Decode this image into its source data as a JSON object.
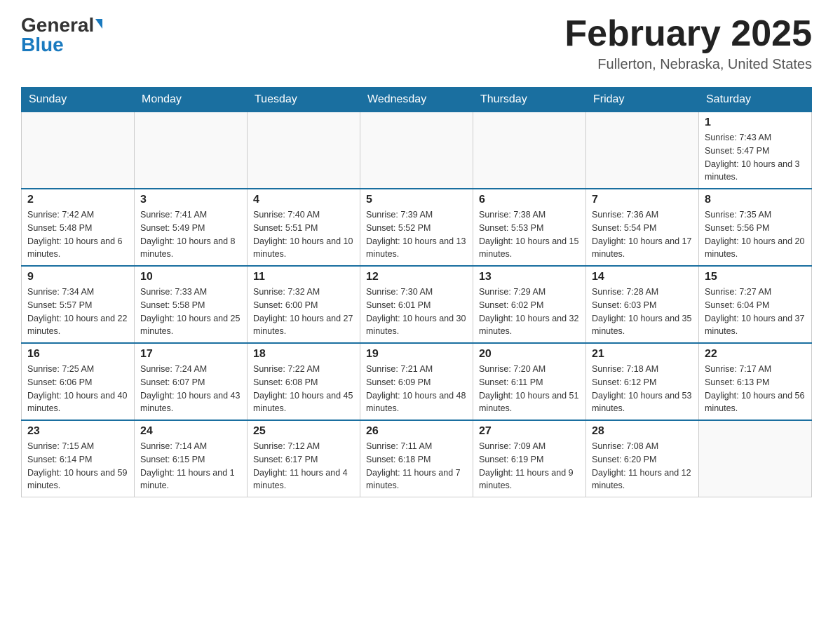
{
  "header": {
    "logo": {
      "general": "General",
      "blue": "Blue"
    },
    "title": "February 2025",
    "subtitle": "Fullerton, Nebraska, United States"
  },
  "weekdays": [
    "Sunday",
    "Monday",
    "Tuesday",
    "Wednesday",
    "Thursday",
    "Friday",
    "Saturday"
  ],
  "weeks": [
    [
      {
        "day": "",
        "info": ""
      },
      {
        "day": "",
        "info": ""
      },
      {
        "day": "",
        "info": ""
      },
      {
        "day": "",
        "info": ""
      },
      {
        "day": "",
        "info": ""
      },
      {
        "day": "",
        "info": ""
      },
      {
        "day": "1",
        "info": "Sunrise: 7:43 AM\nSunset: 5:47 PM\nDaylight: 10 hours and 3 minutes."
      }
    ],
    [
      {
        "day": "2",
        "info": "Sunrise: 7:42 AM\nSunset: 5:48 PM\nDaylight: 10 hours and 6 minutes."
      },
      {
        "day": "3",
        "info": "Sunrise: 7:41 AM\nSunset: 5:49 PM\nDaylight: 10 hours and 8 minutes."
      },
      {
        "day": "4",
        "info": "Sunrise: 7:40 AM\nSunset: 5:51 PM\nDaylight: 10 hours and 10 minutes."
      },
      {
        "day": "5",
        "info": "Sunrise: 7:39 AM\nSunset: 5:52 PM\nDaylight: 10 hours and 13 minutes."
      },
      {
        "day": "6",
        "info": "Sunrise: 7:38 AM\nSunset: 5:53 PM\nDaylight: 10 hours and 15 minutes."
      },
      {
        "day": "7",
        "info": "Sunrise: 7:36 AM\nSunset: 5:54 PM\nDaylight: 10 hours and 17 minutes."
      },
      {
        "day": "8",
        "info": "Sunrise: 7:35 AM\nSunset: 5:56 PM\nDaylight: 10 hours and 20 minutes."
      }
    ],
    [
      {
        "day": "9",
        "info": "Sunrise: 7:34 AM\nSunset: 5:57 PM\nDaylight: 10 hours and 22 minutes."
      },
      {
        "day": "10",
        "info": "Sunrise: 7:33 AM\nSunset: 5:58 PM\nDaylight: 10 hours and 25 minutes."
      },
      {
        "day": "11",
        "info": "Sunrise: 7:32 AM\nSunset: 6:00 PM\nDaylight: 10 hours and 27 minutes."
      },
      {
        "day": "12",
        "info": "Sunrise: 7:30 AM\nSunset: 6:01 PM\nDaylight: 10 hours and 30 minutes."
      },
      {
        "day": "13",
        "info": "Sunrise: 7:29 AM\nSunset: 6:02 PM\nDaylight: 10 hours and 32 minutes."
      },
      {
        "day": "14",
        "info": "Sunrise: 7:28 AM\nSunset: 6:03 PM\nDaylight: 10 hours and 35 minutes."
      },
      {
        "day": "15",
        "info": "Sunrise: 7:27 AM\nSunset: 6:04 PM\nDaylight: 10 hours and 37 minutes."
      }
    ],
    [
      {
        "day": "16",
        "info": "Sunrise: 7:25 AM\nSunset: 6:06 PM\nDaylight: 10 hours and 40 minutes."
      },
      {
        "day": "17",
        "info": "Sunrise: 7:24 AM\nSunset: 6:07 PM\nDaylight: 10 hours and 43 minutes."
      },
      {
        "day": "18",
        "info": "Sunrise: 7:22 AM\nSunset: 6:08 PM\nDaylight: 10 hours and 45 minutes."
      },
      {
        "day": "19",
        "info": "Sunrise: 7:21 AM\nSunset: 6:09 PM\nDaylight: 10 hours and 48 minutes."
      },
      {
        "day": "20",
        "info": "Sunrise: 7:20 AM\nSunset: 6:11 PM\nDaylight: 10 hours and 51 minutes."
      },
      {
        "day": "21",
        "info": "Sunrise: 7:18 AM\nSunset: 6:12 PM\nDaylight: 10 hours and 53 minutes."
      },
      {
        "day": "22",
        "info": "Sunrise: 7:17 AM\nSunset: 6:13 PM\nDaylight: 10 hours and 56 minutes."
      }
    ],
    [
      {
        "day": "23",
        "info": "Sunrise: 7:15 AM\nSunset: 6:14 PM\nDaylight: 10 hours and 59 minutes."
      },
      {
        "day": "24",
        "info": "Sunrise: 7:14 AM\nSunset: 6:15 PM\nDaylight: 11 hours and 1 minute."
      },
      {
        "day": "25",
        "info": "Sunrise: 7:12 AM\nSunset: 6:17 PM\nDaylight: 11 hours and 4 minutes."
      },
      {
        "day": "26",
        "info": "Sunrise: 7:11 AM\nSunset: 6:18 PM\nDaylight: 11 hours and 7 minutes."
      },
      {
        "day": "27",
        "info": "Sunrise: 7:09 AM\nSunset: 6:19 PM\nDaylight: 11 hours and 9 minutes."
      },
      {
        "day": "28",
        "info": "Sunrise: 7:08 AM\nSunset: 6:20 PM\nDaylight: 11 hours and 12 minutes."
      },
      {
        "day": "",
        "info": ""
      }
    ]
  ]
}
